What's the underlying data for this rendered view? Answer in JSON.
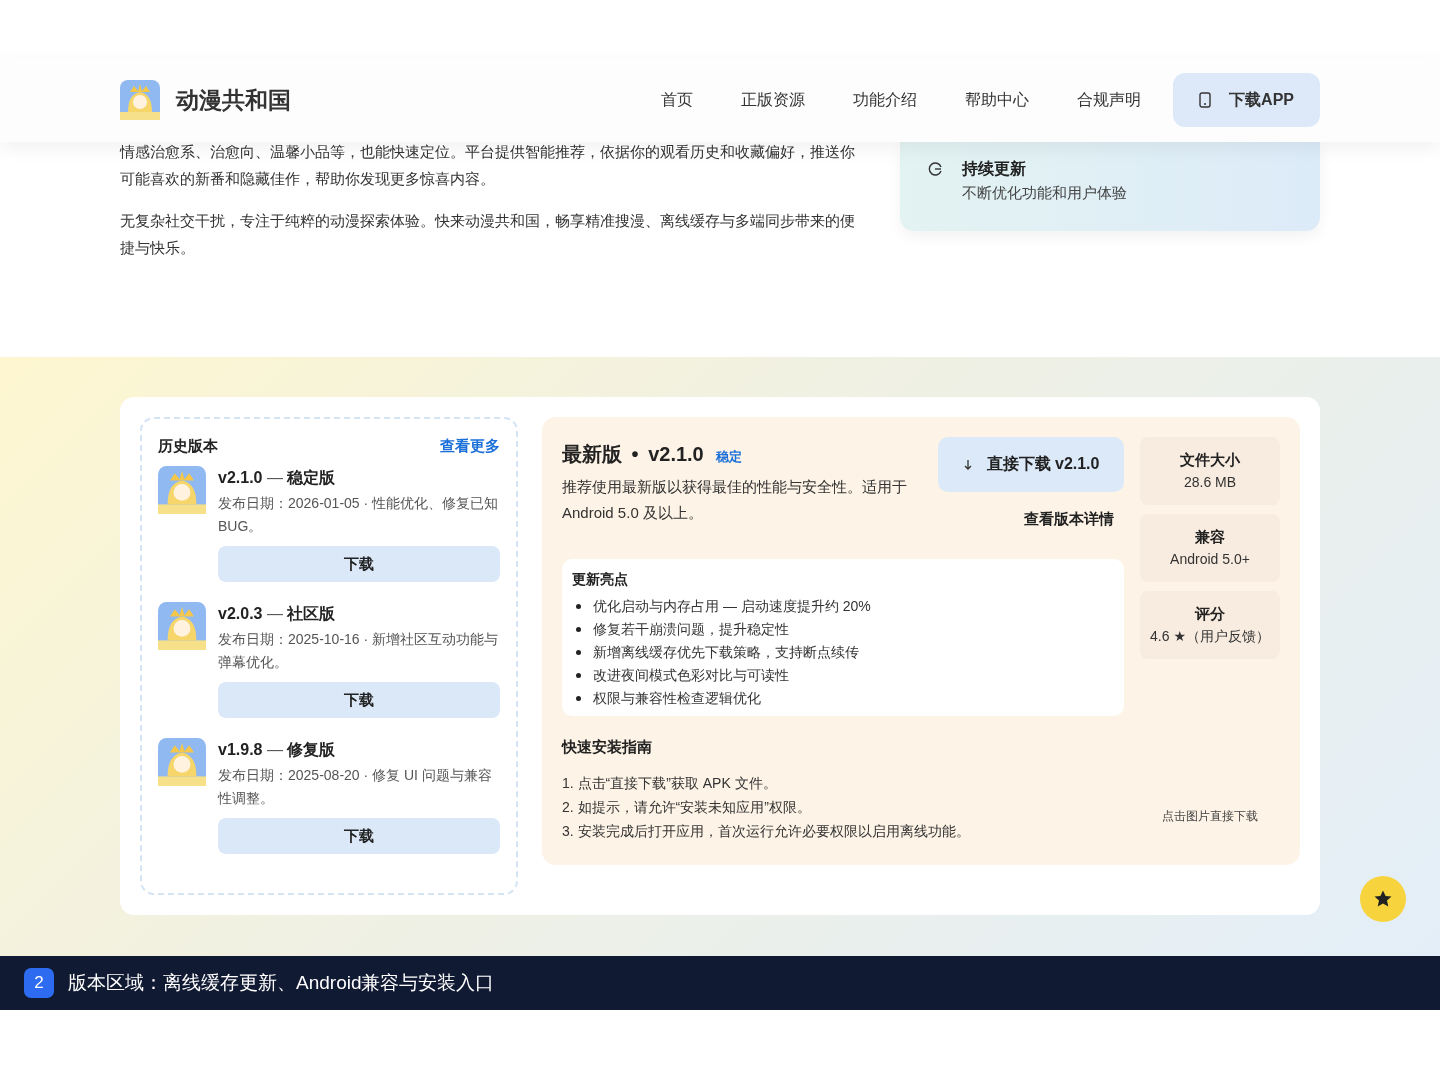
{
  "header": {
    "brand": "动漫共和国",
    "nav": [
      "首页",
      "正版资源",
      "功能介绍",
      "帮助中心",
      "合规声明"
    ],
    "download_button": "下载APP"
  },
  "intro": {
    "paragraphs": [
      "情感治愈系、治愈向、温馨小品等，也能快速定位。平台提供智能推荐，依据你的观看历史和收藏偏好，推送你可能喜欢的新番和隐藏佳作，帮助你发现更多惊喜内容。",
      "无复杂社交干扰，专注于纯粹的动漫探索体验。快来动漫共和国，畅享精准搜漫、离线缓存与多端同步带来的便捷与快乐。"
    ],
    "feature": {
      "title": "持续更新",
      "text": "不断优化功能和用户体验"
    }
  },
  "history": {
    "title": "历史版本",
    "more_link": "查看更多",
    "versions": [
      {
        "version": "v2.1.0",
        "separator": "—",
        "channel": "稳定版",
        "meta": "发布日期：2026-01-05 · 性能优化、修复已知BUG。",
        "button": "下载"
      },
      {
        "version": "v2.0.3",
        "separator": "—",
        "channel": "社区版",
        "meta": "发布日期：2025-10-16 · 新增社区互动功能与弹幕优化。",
        "button": "下载"
      },
      {
        "version": "v1.9.8",
        "separator": "—",
        "channel": "修复版",
        "meta": "发布日期：2025-08-20 · 修复 UI 问题与兼容性调整。",
        "button": "下载"
      }
    ]
  },
  "latest": {
    "title": "最新版",
    "dot": "•",
    "version": "v2.1.0",
    "badge": "稳定",
    "description": "推荐使用最新版以获得最佳的性能与安全性。适用于 Android 5.0 及以上。",
    "download_button": "直接下载 v2.1.0",
    "details_link": "查看版本详情",
    "highlights": {
      "title": "更新亮点",
      "items": [
        "优化启动与内存占用 — 启动速度提升约 20%",
        "修复若干崩溃问题，提升稳定性",
        "新增离线缓存优先下载策略，支持断点续传",
        "改进夜间模式色彩对比与可读性",
        "权限与兼容性检查逻辑优化"
      ]
    },
    "guide": {
      "title": "快速安装指南",
      "steps": [
        "1. 点击“直接下载”获取 APK 文件。",
        "2. 如提示，请允许“安装未知应用”权限。",
        "3. 安装完成后打开应用，首次运行允许必要权限以启用离线功能。"
      ]
    },
    "stats": [
      {
        "label": "文件大小",
        "value": "28.6 MB"
      },
      {
        "label": "兼容",
        "value": "Android 5.0+"
      },
      {
        "label": "评分",
        "value": "4.6 ★（用户反馈）"
      }
    ],
    "qr_caption": "点击图片直接下载"
  },
  "caption_bar": {
    "number": "2",
    "text": "版本区域：离线缓存更新、Android兼容与安装入口"
  }
}
